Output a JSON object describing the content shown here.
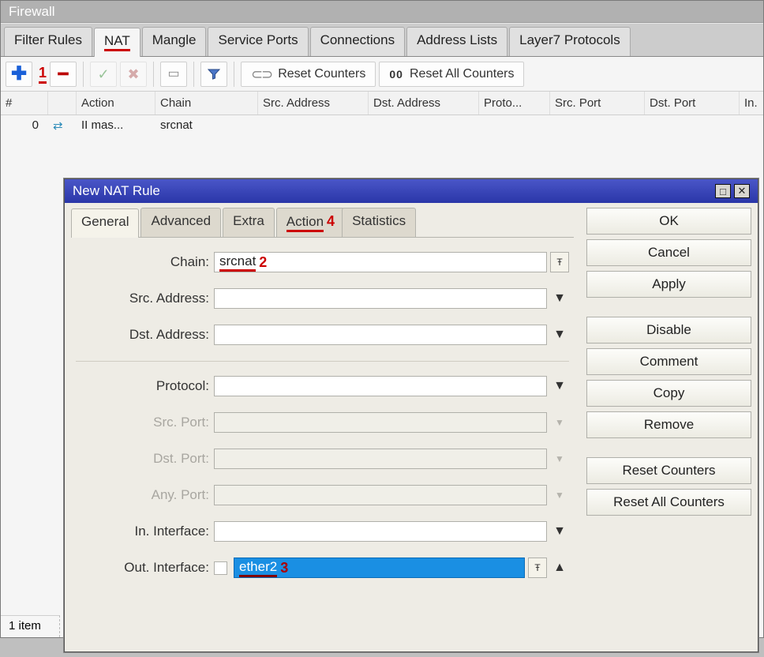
{
  "window": {
    "title": "Firewall",
    "tabs": [
      {
        "label": "Filter Rules"
      },
      {
        "label": "NAT",
        "active": true
      },
      {
        "label": "Mangle"
      },
      {
        "label": "Service Ports"
      },
      {
        "label": "Connections"
      },
      {
        "label": "Address Lists"
      },
      {
        "label": "Layer7 Protocols"
      }
    ],
    "toolbar": {
      "add_annot": "1",
      "reset_counters": "Reset Counters",
      "reset_all_counters": "Reset All Counters"
    },
    "columns": [
      "#",
      "",
      "Action",
      "Chain",
      "Src. Address",
      "Dst. Address",
      "Proto...",
      "Src. Port",
      "Dst. Port",
      "In."
    ],
    "rows": [
      {
        "num": "0",
        "icon": "⇄",
        "action": "II mas...",
        "chain": "srcnat"
      }
    ],
    "status": "1 item"
  },
  "dialog": {
    "title": "New NAT Rule",
    "tabs": [
      {
        "label": "General",
        "active": true
      },
      {
        "label": "Advanced"
      },
      {
        "label": "Extra"
      },
      {
        "label": "Action",
        "annot": "4"
      },
      {
        "label": "Statistics"
      }
    ],
    "form": {
      "chain_label": "Chain:",
      "chain_value": "srcnat",
      "chain_annot": "2",
      "src_addr_label": "Src. Address:",
      "dst_addr_label": "Dst. Address:",
      "protocol_label": "Protocol:",
      "src_port_label": "Src. Port:",
      "dst_port_label": "Dst. Port:",
      "any_port_label": "Any. Port:",
      "in_iface_label": "In. Interface:",
      "out_iface_label": "Out. Interface:",
      "out_iface_value": "ether2",
      "out_iface_annot": "3"
    },
    "buttons": {
      "ok": "OK",
      "cancel": "Cancel",
      "apply": "Apply",
      "disable": "Disable",
      "comment": "Comment",
      "copy": "Copy",
      "remove": "Remove",
      "reset_counters": "Reset Counters",
      "reset_all_counters": "Reset All Counters"
    }
  }
}
